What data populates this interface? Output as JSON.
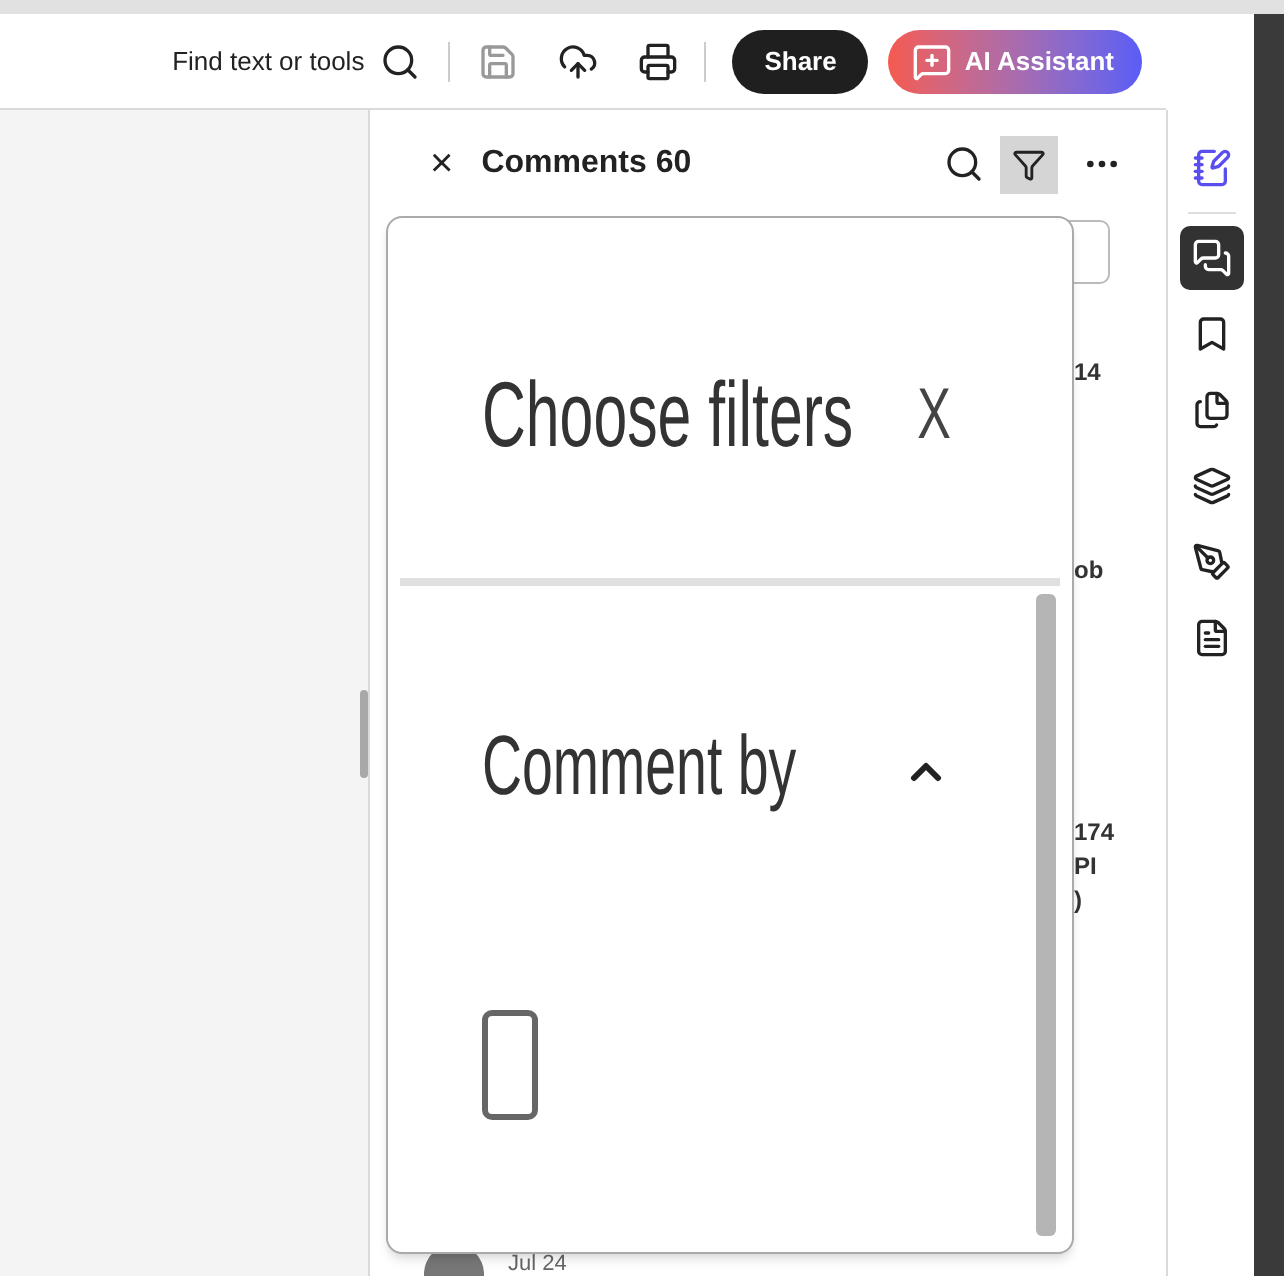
{
  "toolbar": {
    "search_label": "Find text or tools",
    "share": "Share",
    "ai_assistant": "AI Assistant"
  },
  "comments_panel": {
    "close": "×",
    "title": "Comments 60",
    "peek_texts": [
      "14",
      "ob",
      "174",
      "PI",
      ")"
    ],
    "date": "Jul 24"
  },
  "rail": [
    {
      "kind": "ai",
      "selected": false
    },
    {
      "kind": "comments",
      "selected": true
    },
    {
      "kind": "bookmarks",
      "selected": false
    },
    {
      "kind": "pages",
      "selected": false
    },
    {
      "kind": "layers",
      "selected": false
    },
    {
      "kind": "sign",
      "selected": false
    },
    {
      "kind": "document",
      "selected": false
    }
  ],
  "filter_popup": {
    "title": "Choose filters",
    "close": "X",
    "section": {
      "title": "Comment by",
      "expanded": true
    },
    "checkbox": {
      "checked": false
    }
  }
}
